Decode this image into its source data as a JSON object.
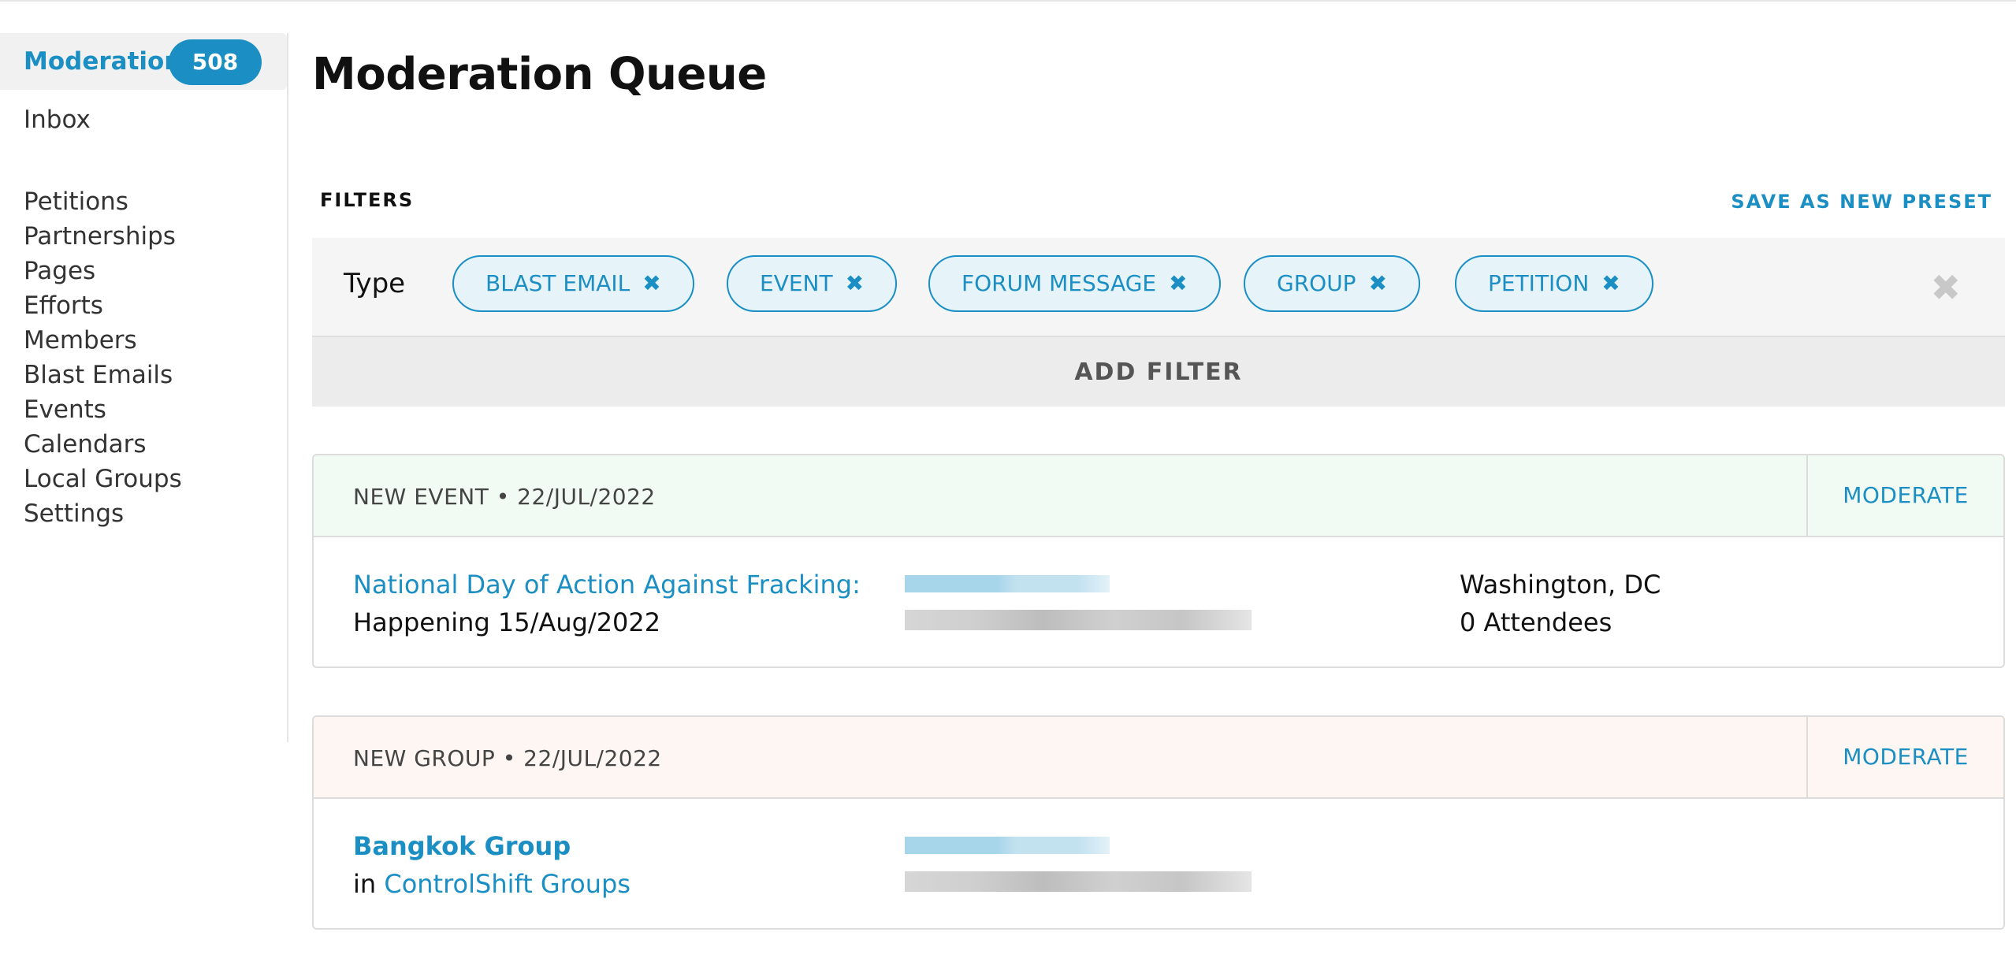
{
  "sidebar": {
    "active": {
      "label": "Moderation",
      "badge": "508"
    },
    "items": [
      "Inbox",
      "Petitions",
      "Partnerships",
      "Pages",
      "Efforts",
      "Members",
      "Blast Emails",
      "Events",
      "Calendars",
      "Local Groups",
      "Settings"
    ]
  },
  "main": {
    "title": "Moderation Queue",
    "filters_label": "FILTERS",
    "save_preset": "SAVE AS NEW PRESET",
    "filter": {
      "type_label": "Type",
      "chips": [
        "BLAST EMAIL",
        "EVENT",
        "FORUM MESSAGE",
        "GROUP",
        "PETITION"
      ],
      "chip_remove_glyph": "✖",
      "clear_glyph": "✖"
    },
    "add_filter": "ADD FILTER"
  },
  "cards": [
    {
      "kind": "NEW EVENT",
      "date": "22/JUL/2022",
      "moderate": "MODERATE",
      "title": "National Day of Action Against Fracking:",
      "subtitle": "Happening 15/Aug/2022",
      "location": "Washington, DC",
      "attendees": "0 Attendees"
    },
    {
      "kind": "NEW GROUP",
      "date": "22/JUL/2022",
      "moderate": "MODERATE",
      "title": "Bangkok Group",
      "in_prefix": "in",
      "parent": "ControlShift Groups"
    }
  ],
  "colors": {
    "accent": "#1b8fc4",
    "event_header": "#f1fbf4",
    "group_header": "#fdf6f3",
    "chip_bg": "#e6f3f9"
  },
  "icons": {
    "chip_remove": "close-icon",
    "filter_clear": "close-icon"
  }
}
